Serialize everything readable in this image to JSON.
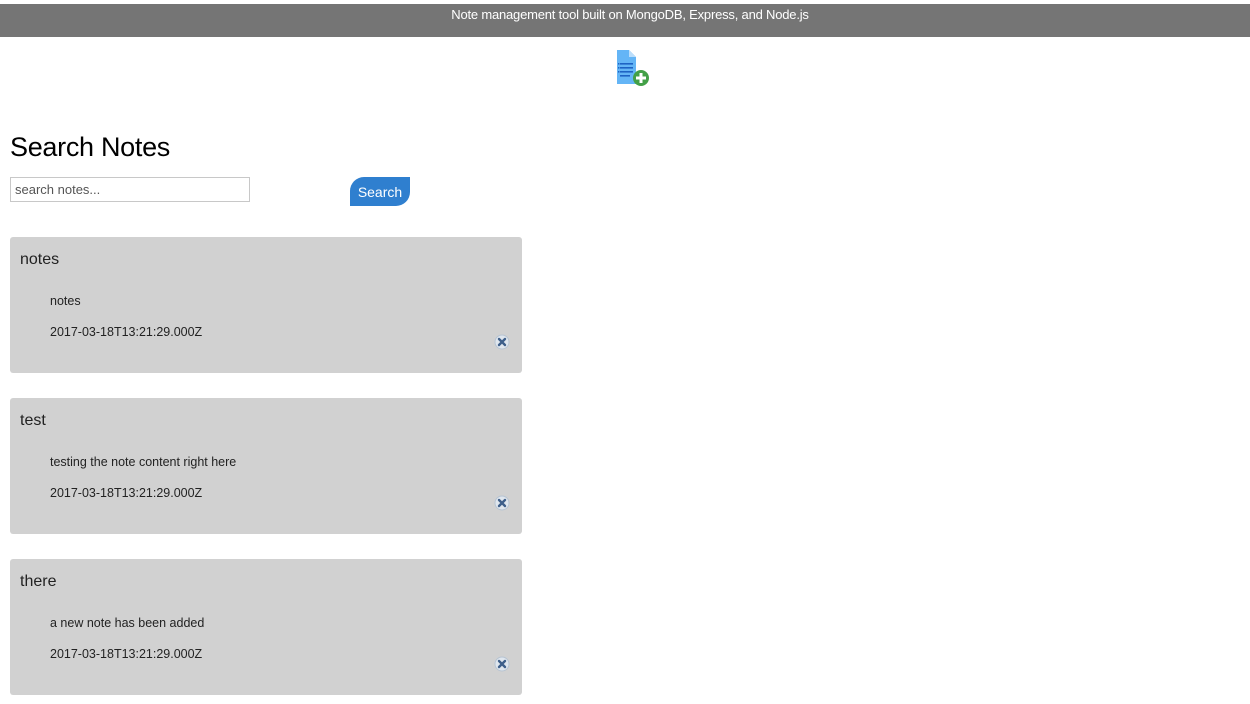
{
  "header": {
    "title": "Note management tool built on MongoDB, Express, and Node.js"
  },
  "toolbar": {
    "add_note_icon": "add-document-icon"
  },
  "search": {
    "title": "Search Notes",
    "placeholder": "search notes...",
    "value": "",
    "button_label": "Search"
  },
  "notes": [
    {
      "title": "notes",
      "body": "notes",
      "date": "2017-03-18T13:21:29.000Z",
      "delete_icon": "close-icon"
    },
    {
      "title": "test",
      "body": "testing the note content right here",
      "date": "2017-03-18T13:21:29.000Z",
      "delete_icon": "close-icon"
    },
    {
      "title": "there",
      "body": "a new note has been added",
      "date": "2017-03-18T13:21:29.000Z",
      "delete_icon": "close-icon"
    }
  ],
  "colors": {
    "header_bg": "#757575",
    "card_bg": "#d1d1d1",
    "accent": "#2f7fcf",
    "add_icon_doc": "#64b5f6",
    "add_icon_plus": "#43a047"
  }
}
